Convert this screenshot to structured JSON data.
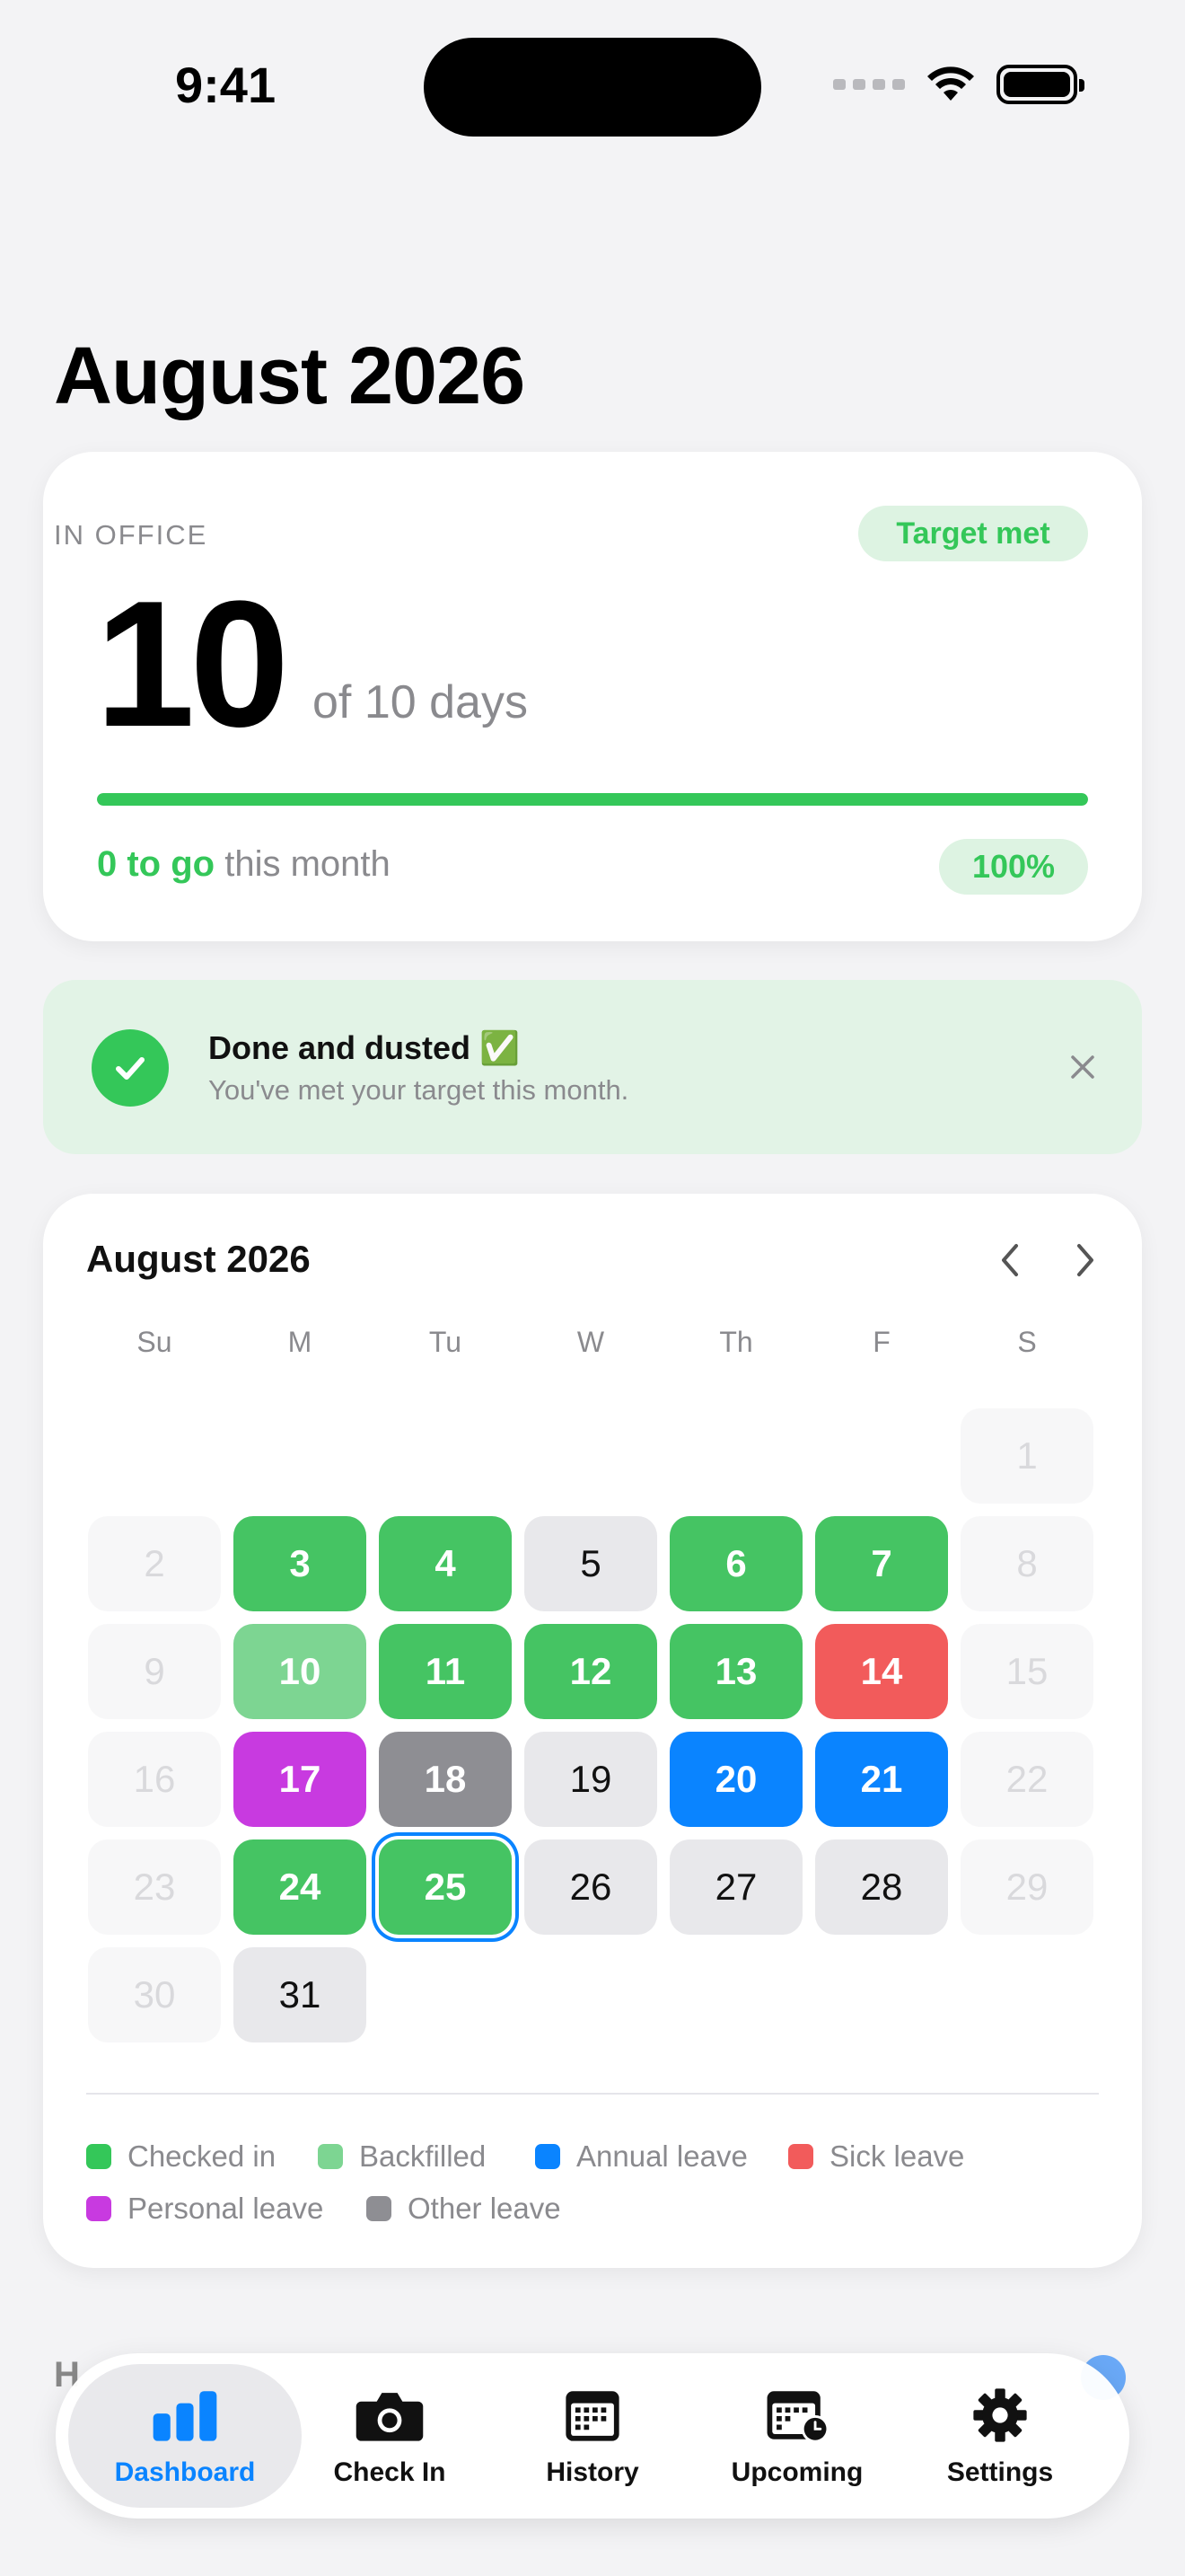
{
  "status_bar": {
    "time": "9:41"
  },
  "page_title": "August 2026",
  "progress_card": {
    "label": "IN OFFICE",
    "badge": "Target met",
    "count": "10",
    "of_days": "of 10 days",
    "progress_fraction": 1.0,
    "to_go_bold": "0 to go",
    "to_go_rest": "this month",
    "percent": "100%"
  },
  "banner": {
    "title": "Done and dusted ✅",
    "subtitle": "You've met your target this month."
  },
  "calendar": {
    "title": "August 2026",
    "weekdays": [
      "Su",
      "M",
      "Tu",
      "W",
      "Th",
      "F",
      "S"
    ],
    "days": [
      {
        "d": "1",
        "state": "out",
        "col": 6,
        "row": 0
      },
      {
        "d": "2",
        "state": "out",
        "col": 0,
        "row": 1
      },
      {
        "d": "3",
        "state": "checked",
        "col": 1,
        "row": 1
      },
      {
        "d": "4",
        "state": "checked",
        "col": 2,
        "row": 1
      },
      {
        "d": "5",
        "state": "plain",
        "col": 3,
        "row": 1
      },
      {
        "d": "6",
        "state": "checked",
        "col": 4,
        "row": 1
      },
      {
        "d": "7",
        "state": "checked",
        "col": 5,
        "row": 1
      },
      {
        "d": "8",
        "state": "out",
        "col": 6,
        "row": 1
      },
      {
        "d": "9",
        "state": "out",
        "col": 0,
        "row": 2
      },
      {
        "d": "10",
        "state": "backfilled",
        "col": 1,
        "row": 2
      },
      {
        "d": "11",
        "state": "checked",
        "col": 2,
        "row": 2
      },
      {
        "d": "12",
        "state": "checked",
        "col": 3,
        "row": 2
      },
      {
        "d": "13",
        "state": "checked",
        "col": 4,
        "row": 2
      },
      {
        "d": "14",
        "state": "sick",
        "col": 5,
        "row": 2
      },
      {
        "d": "15",
        "state": "out",
        "col": 6,
        "row": 2
      },
      {
        "d": "16",
        "state": "out",
        "col": 0,
        "row": 3
      },
      {
        "d": "17",
        "state": "personal",
        "col": 1,
        "row": 3
      },
      {
        "d": "18",
        "state": "other",
        "col": 2,
        "row": 3
      },
      {
        "d": "19",
        "state": "plain",
        "col": 3,
        "row": 3
      },
      {
        "d": "20",
        "state": "annual",
        "col": 4,
        "row": 3
      },
      {
        "d": "21",
        "state": "annual",
        "col": 5,
        "row": 3
      },
      {
        "d": "22",
        "state": "out",
        "col": 6,
        "row": 3
      },
      {
        "d": "23",
        "state": "out",
        "col": 0,
        "row": 4
      },
      {
        "d": "24",
        "state": "checked",
        "col": 1,
        "row": 4
      },
      {
        "d": "25",
        "state": "checked",
        "col": 2,
        "row": 4,
        "today": true
      },
      {
        "d": "26",
        "state": "plain",
        "col": 3,
        "row": 4
      },
      {
        "d": "27",
        "state": "plain",
        "col": 4,
        "row": 4
      },
      {
        "d": "28",
        "state": "plain",
        "col": 5,
        "row": 4
      },
      {
        "d": "29",
        "state": "out",
        "col": 6,
        "row": 4
      },
      {
        "d": "30",
        "state": "out",
        "col": 0,
        "row": 5
      },
      {
        "d": "31",
        "state": "plain",
        "col": 1,
        "row": 5
      }
    ],
    "legend": [
      {
        "label": "Checked in",
        "color": "#34c759"
      },
      {
        "label": "Backfilled",
        "color": "#7dd592"
      },
      {
        "label": "Annual leave",
        "color": "#0a84ff"
      },
      {
        "label": "Sick leave",
        "color": "#f25b5b"
      },
      {
        "label": "Personal leave",
        "color": "#c83ae0"
      },
      {
        "label": "Other leave",
        "color": "#8e8e93"
      }
    ]
  },
  "peek": {
    "letter": "H"
  },
  "tabs": [
    {
      "label": "Dashboard",
      "icon": "chart-bars-icon",
      "active": true
    },
    {
      "label": "Check In",
      "icon": "camera-icon"
    },
    {
      "label": "History",
      "icon": "calendar-icon"
    },
    {
      "label": "Upcoming",
      "icon": "calendar-clock-icon"
    },
    {
      "label": "Settings",
      "icon": "gear-icon"
    }
  ],
  "colors": {
    "accent": "#0a84ff",
    "success": "#34c759"
  }
}
